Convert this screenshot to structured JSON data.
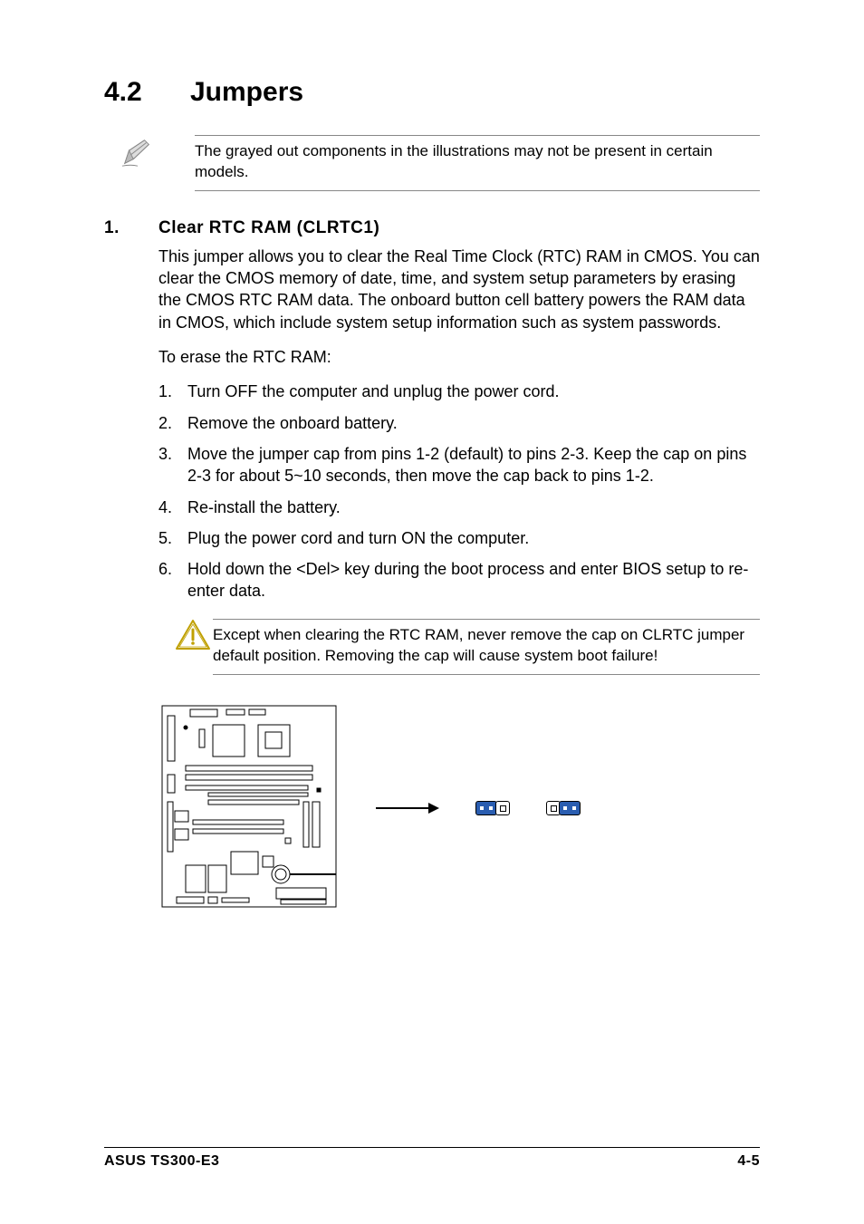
{
  "section": {
    "number": "4.2",
    "title": "Jumpers"
  },
  "note1": "The grayed out components in the illustrations may not be present in certain models.",
  "sub": {
    "number": "1.",
    "title": "Clear RTC RAM (CLRTC1)"
  },
  "intro": "This jumper allows you to clear the  Real Time Clock (RTC) RAM in CMOS. You can clear the CMOS memory of date, time, and system setup parameters by erasing the CMOS RTC RAM data. The onboard button cell battery powers the RAM data in CMOS, which include system setup information such as system passwords.",
  "erase_intro": "To erase the RTC RAM:",
  "steps": [
    {
      "n": "1.",
      "t": "Turn OFF the computer and unplug the power cord."
    },
    {
      "n": "2.",
      "t": "Remove the onboard battery."
    },
    {
      "n": "3.",
      "t": "Move the jumper cap from pins 1-2 (default) to pins 2-3. Keep the cap on pins 2-3 for about 5~10 seconds, then move the cap back to pins  1-2."
    },
    {
      "n": "4.",
      "t": "Re-install the battery."
    },
    {
      "n": "5.",
      "t": "Plug the power cord and turn ON the computer."
    },
    {
      "n": "6.",
      "t": "Hold down the <Del> key during the boot process and enter BIOS setup to re-enter data."
    }
  ],
  "warning": "Except when clearing the RTC RAM, never remove the cap on CLRTC jumper default position. Removing the cap will cause system boot failure!",
  "footer": {
    "left": "ASUS TS300-E3",
    "right": "4-5"
  }
}
